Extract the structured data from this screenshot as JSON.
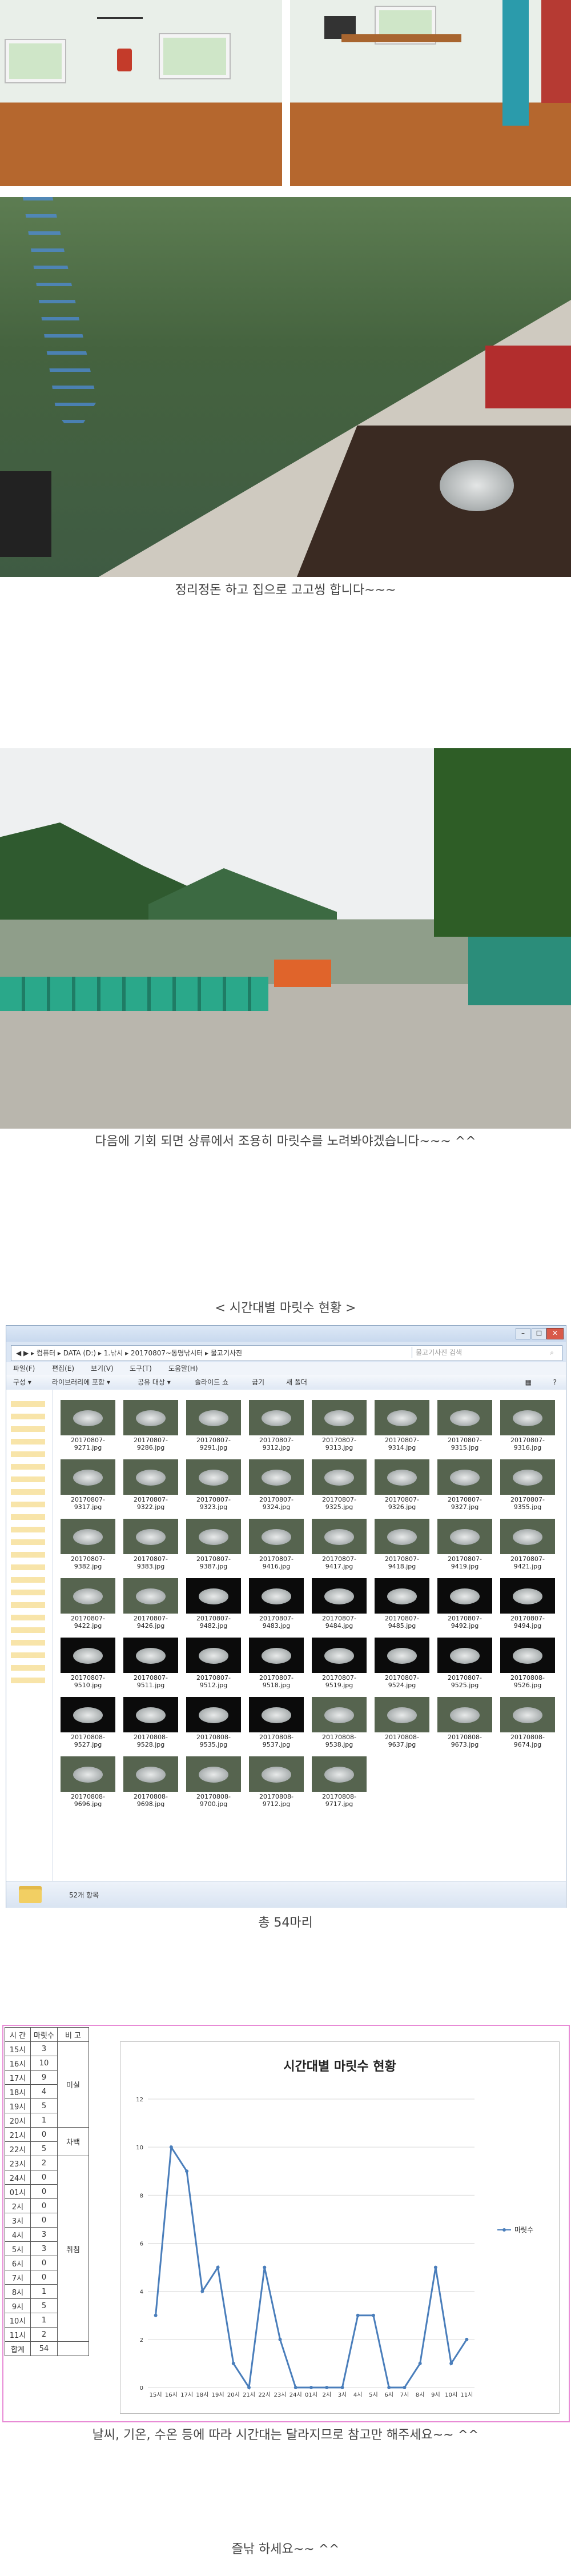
{
  "captions": {
    "c1": "정리정돈 하고 집으로 고고씽 합니다~~~",
    "c2": "다음에 기회 되면 상류에서 조용히 마릿수를 노려봐야겠습니다~~~ ^^",
    "c3": "< 시간대별 마릿수 현황 >",
    "c4": "총 54마리",
    "c5": "날씨, 기온, 수온 등에 따라 시간대는 달라지므로 참고만 해주세요~~ ^^",
    "c6": "즐낚 하세요~~ ^^"
  },
  "explorer": {
    "address": "◀ ▶ ▸ 컴퓨터 ▸ DATA (D:) ▸ 1.낚시 ▸ 20170807~동명낚시터 ▸ 물고기사진",
    "search_placeholder": "물고기사진 검색",
    "menu": [
      "파일(F)",
      "편집(E)",
      "보기(V)",
      "도구(T)",
      "도움말(H)"
    ],
    "toolbar": [
      "구성 ▾",
      "라이브러리에 포함 ▾",
      "공유 대상 ▾",
      "슬라이드 쇼",
      "굽기",
      "새 폴더"
    ],
    "status": "52개 항목",
    "files": [
      {
        "name": "20170807-9271.jpg",
        "dark": false
      },
      {
        "name": "20170807-9286.jpg",
        "dark": false
      },
      {
        "name": "20170807-9291.jpg",
        "dark": false
      },
      {
        "name": "20170807-9312.jpg",
        "dark": false
      },
      {
        "name": "20170807-9313.jpg",
        "dark": false
      },
      {
        "name": "20170807-9314.jpg",
        "dark": false
      },
      {
        "name": "20170807-9315.jpg",
        "dark": false
      },
      {
        "name": "20170807-9316.jpg",
        "dark": false
      },
      {
        "name": "20170807-9317.jpg",
        "dark": false
      },
      {
        "name": "20170807-9322.jpg",
        "dark": false
      },
      {
        "name": "20170807-9323.jpg",
        "dark": false
      },
      {
        "name": "20170807-9324.jpg",
        "dark": false
      },
      {
        "name": "20170807-9325.jpg",
        "dark": false
      },
      {
        "name": "20170807-9326.jpg",
        "dark": false
      },
      {
        "name": "20170807-9327.jpg",
        "dark": false
      },
      {
        "name": "20170807-9355.jpg",
        "dark": false
      },
      {
        "name": "20170807-9382.jpg",
        "dark": false
      },
      {
        "name": "20170807-9383.jpg",
        "dark": false
      },
      {
        "name": "20170807-9387.jpg",
        "dark": false
      },
      {
        "name": "20170807-9416.jpg",
        "dark": false
      },
      {
        "name": "20170807-9417.jpg",
        "dark": false
      },
      {
        "name": "20170807-9418.jpg",
        "dark": false
      },
      {
        "name": "20170807-9419.jpg",
        "dark": false
      },
      {
        "name": "20170807-9421.jpg",
        "dark": false
      },
      {
        "name": "20170807-9422.jpg",
        "dark": false
      },
      {
        "name": "20170807-9426.jpg",
        "dark": false
      },
      {
        "name": "20170807-9482.jpg",
        "dark": true
      },
      {
        "name": "20170807-9483.jpg",
        "dark": true
      },
      {
        "name": "20170807-9484.jpg",
        "dark": true
      },
      {
        "name": "20170807-9485.jpg",
        "dark": true
      },
      {
        "name": "20170807-9492.jpg",
        "dark": true
      },
      {
        "name": "20170807-9494.jpg",
        "dark": true
      },
      {
        "name": "20170807-9510.jpg",
        "dark": true
      },
      {
        "name": "20170807-9511.jpg",
        "dark": true
      },
      {
        "name": "20170807-9512.jpg",
        "dark": true
      },
      {
        "name": "20170807-9518.jpg",
        "dark": true
      },
      {
        "name": "20170807-9519.jpg",
        "dark": true
      },
      {
        "name": "20170807-9524.jpg",
        "dark": true
      },
      {
        "name": "20170807-9525.jpg",
        "dark": true
      },
      {
        "name": "20170808-9526.jpg",
        "dark": true
      },
      {
        "name": "20170808-9527.jpg",
        "dark": true
      },
      {
        "name": "20170808-9528.jpg",
        "dark": true
      },
      {
        "name": "20170808-9535.jpg",
        "dark": true
      },
      {
        "name": "20170808-9537.jpg",
        "dark": true
      },
      {
        "name": "20170808-9538.jpg",
        "dark": false
      },
      {
        "name": "20170808-9637.jpg",
        "dark": false
      },
      {
        "name": "20170808-9673.jpg",
        "dark": false
      },
      {
        "name": "20170808-9674.jpg",
        "dark": false
      },
      {
        "name": "20170808-9696.jpg",
        "dark": false
      },
      {
        "name": "20170808-9698.jpg",
        "dark": false
      },
      {
        "name": "20170808-9700.jpg",
        "dark": false
      },
      {
        "name": "20170808-9712.jpg",
        "dark": false
      },
      {
        "name": "20170808-9717.jpg",
        "dark": false
      }
    ]
  },
  "table": {
    "headers": [
      "시 간",
      "마릿수",
      "비 고"
    ],
    "rows": [
      [
        "15시",
        "3"
      ],
      [
        "16시",
        "10"
      ],
      [
        "17시",
        "9"
      ],
      [
        "18시",
        "4"
      ],
      [
        "19시",
        "5"
      ],
      [
        "20시",
        "1"
      ],
      [
        "21시",
        "0"
      ],
      [
        "22시",
        "5"
      ],
      [
        "23시",
        "2"
      ],
      [
        "24시",
        "0"
      ],
      [
        "01시",
        "0"
      ],
      [
        "2시",
        "0"
      ],
      [
        "3시",
        "0"
      ],
      [
        "4시",
        "3"
      ],
      [
        "5시",
        "3"
      ],
      [
        "6시",
        "0"
      ],
      [
        "7시",
        "0"
      ],
      [
        "8시",
        "1"
      ],
      [
        "9시",
        "5"
      ],
      [
        "10시",
        "1"
      ],
      [
        "11시",
        "2"
      ]
    ],
    "total": [
      "합계",
      "54"
    ],
    "notes": {
      "n1": "미실",
      "n2": "차백",
      "n3": "취침"
    }
  },
  "chart_data": {
    "type": "line",
    "title": "시간대별 마릿수 현황",
    "xlabel": "",
    "ylabel": "",
    "categories": [
      "15시",
      "16시",
      "17시",
      "18시",
      "19시",
      "20시",
      "21시",
      "22시",
      "23시",
      "24시",
      "01시",
      "2시",
      "3시",
      "4시",
      "5시",
      "6시",
      "7시",
      "8시",
      "9시",
      "10시",
      "11시"
    ],
    "series": [
      {
        "name": "마릿수",
        "values": [
          3,
          10,
          9,
          4,
          5,
          1,
          0,
          5,
          2,
          0,
          0,
          0,
          0,
          3,
          3,
          0,
          0,
          1,
          5,
          1,
          2
        ]
      }
    ],
    "ylim": [
      0,
      12
    ],
    "yticks": [
      "0",
      "2",
      "4",
      "6",
      "8",
      "10",
      "12"
    ],
    "grid": true,
    "legend": "right",
    "colors": {
      "line": "#4a7ebb"
    }
  }
}
